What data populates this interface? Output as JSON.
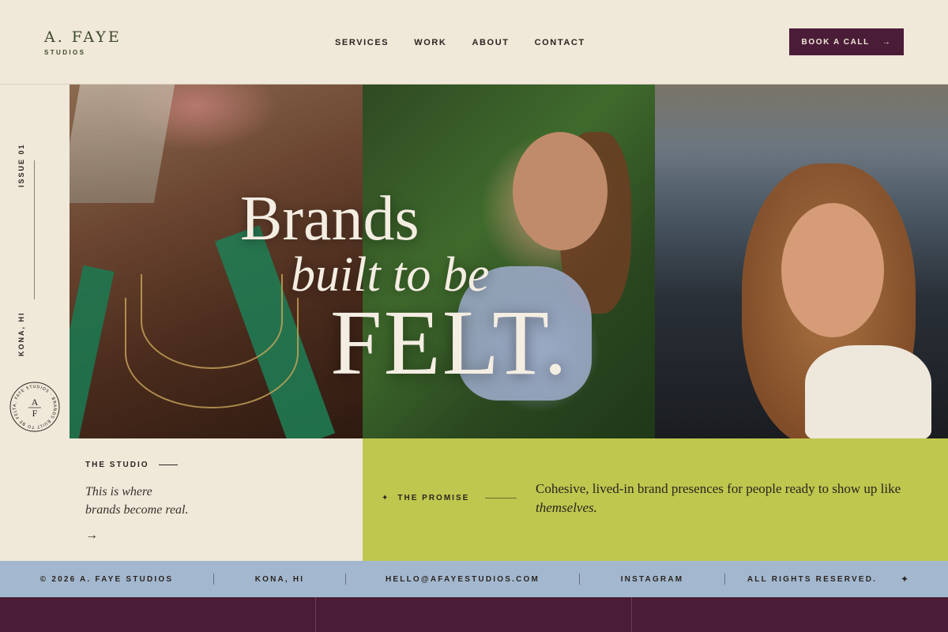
{
  "header": {
    "logo_main": "A. FAYE",
    "logo_sub": "STUDIOS",
    "nav": [
      "SERVICES",
      "WORK",
      "ABOUT",
      "CONTACT"
    ],
    "cta_label": "BOOK A CALL",
    "cta_arrow": "→"
  },
  "rail": {
    "issue": "ISSUE 01",
    "location": "KONA, HI",
    "seal_ring": "A. FAYE STUDIOS · BRANDS BUILT TO BE FELT ·",
    "seal_top": "A",
    "seal_bottom": "F"
  },
  "hero": {
    "line1": "Brands",
    "line2": "built to be",
    "line3": "FELT."
  },
  "studio": {
    "label": "THE STUDIO",
    "text_line1": "This is where",
    "text_line2": "brands become real.",
    "arrow": "→"
  },
  "promise": {
    "icon": "✦",
    "label": "THE PROMISE",
    "text_main": "Cohesive, lived-in brand presences for people ready to show up like",
    "text_italic": "themselves."
  },
  "footer": {
    "copyright": "© 2026 A. FAYE STUDIOS",
    "location": "KONA, HI",
    "email": "HELLO@AFAYESTUDIOS.COM",
    "social": "INSTAGRAM",
    "rights": "ALL RIGHTS RESERVED.",
    "star": "✦"
  },
  "colors": {
    "background": "#f0e8d9",
    "plum": "#4a1c37",
    "chartreuse": "#bfc74e",
    "sky": "#a3b8cf",
    "olive_text": "#3f4a2c"
  }
}
